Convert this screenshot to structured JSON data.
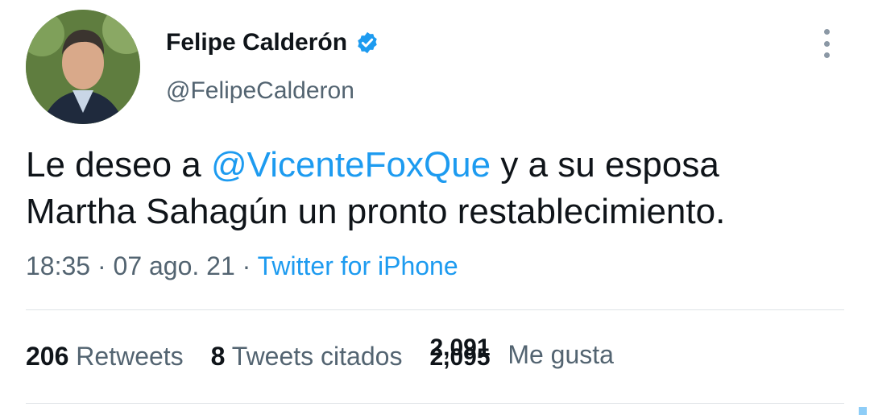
{
  "tweet": {
    "author": {
      "display_name": "Felipe Calderón",
      "handle": "@FelipeCalderon",
      "verified": true
    },
    "text": {
      "before_mention": "Le deseo a ",
      "mention": "@VicenteFoxQue",
      "line1_after_mention": " y a su esposa",
      "line2": "Martha Sahagún un pronto restablecimiento."
    },
    "meta": {
      "time": "18:35",
      "separator": " · ",
      "date": "07 ago. 21",
      "source": "Twitter for iPhone"
    },
    "stats": {
      "retweets_count": "206",
      "retweets_label": "Retweets",
      "quotes_count": "8",
      "quotes_label": "Tweets citados",
      "likes_count_old": "2,091",
      "likes_count_new": "2,095",
      "likes_label": "Me gusta"
    }
  },
  "colors": {
    "link": "#1d9bf0",
    "secondary_text": "#536471",
    "primary_text": "#0f1419",
    "verified_badge": "#1d9bf0"
  },
  "icons": {
    "verified": "verified-badge-icon",
    "more": "more-vertical-icon"
  }
}
